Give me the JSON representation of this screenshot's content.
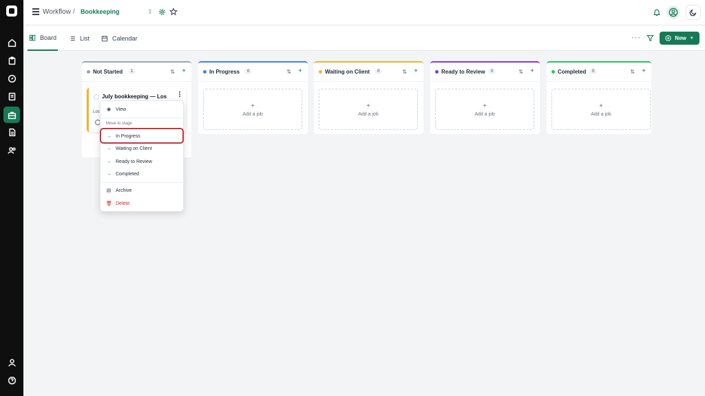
{
  "breadcrumb": {
    "root": "Workflow",
    "separator": "/",
    "current": "Bookkeeping"
  },
  "tabs": [
    {
      "label": "Board",
      "icon": "board-icon",
      "active": true
    },
    {
      "label": "List",
      "icon": "list-icon",
      "active": false
    },
    {
      "label": "Calendar",
      "icon": "calendar-icon",
      "active": false
    }
  ],
  "toolbar": {
    "more_label": "···",
    "new_label": "New"
  },
  "columns": [
    {
      "title": "Not Started",
      "count": "1",
      "color": "#9ca3af"
    },
    {
      "title": "In Progress",
      "count": "0",
      "color": "#3b82f6"
    },
    {
      "title": "Waiting on Client",
      "count": "0",
      "color": "#f0b429"
    },
    {
      "title": "Ready to Review",
      "count": "0",
      "color": "#7c3aed"
    },
    {
      "title": "Completed",
      "count": "0",
      "color": "#22c55e"
    }
  ],
  "add_job_label": "Add a job",
  "card": {
    "title": "July bookkeeping — Los",
    "subtitle": "Los"
  },
  "context_menu": {
    "view": "View",
    "section_label": "Move to stage",
    "stages": [
      "In Progress",
      "Waiting on Client",
      "Ready to Review",
      "Completed"
    ],
    "archive": "Archive",
    "delete": "Delete"
  },
  "colors": {
    "brand": "#157a55",
    "highlight": "#c0393b",
    "danger": "#dc2626"
  }
}
